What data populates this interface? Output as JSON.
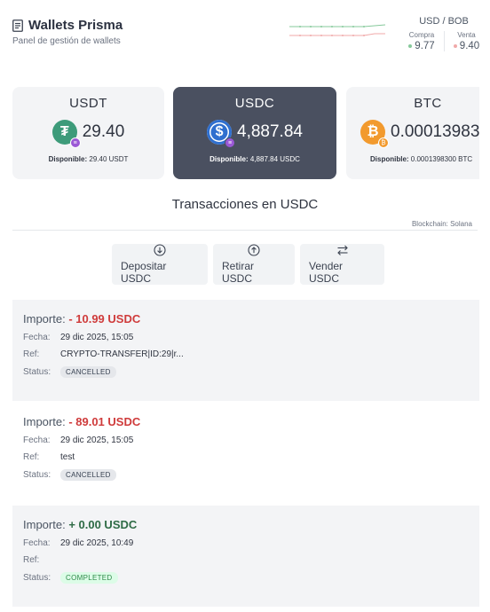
{
  "header": {
    "title": "Wallets Prisma",
    "subtitle": "Panel de gestión de wallets",
    "icon": "document-icon"
  },
  "rate": {
    "pair": "USD / BOB",
    "buy_label": "Compra",
    "sell_label": "Venta",
    "buy_value": "9.77",
    "sell_value": "9.40",
    "colors": {
      "buy": "#86c99b",
      "sell": "#f0a9a9"
    }
  },
  "cards": [
    {
      "name": "USDT",
      "balance": "29.40",
      "avail_label": "Disponible:",
      "avail_value": "29.40 USDT",
      "icon": "tether-icon",
      "color": "#3d9b7a",
      "badge_color": "#9b59d6",
      "active": false
    },
    {
      "name": "USDC",
      "balance": "4,887.84",
      "avail_label": "Disponible:",
      "avail_value": "4,887.84 USDC",
      "icon": "usdc-icon",
      "color": "#2f6fcf",
      "badge_color": "#9b59d6",
      "active": true
    },
    {
      "name": "BTC",
      "balance": "0.00013983",
      "avail_label": "Disponible:",
      "avail_value": "0.0001398300 BTC",
      "icon": "bitcoin-icon",
      "color": "#f29a2e",
      "badge_color": "#f29a2e",
      "active": false
    }
  ],
  "section": {
    "title": "Transacciones en USDC",
    "chain": "Blockchain: Solana"
  },
  "actions": [
    {
      "label": "Depositar USDC",
      "icon": "arrow-down-circle-icon"
    },
    {
      "label": "Retirar USDC",
      "icon": "arrow-up-circle-icon"
    },
    {
      "label": "Vender USDC",
      "icon": "swap-icon"
    }
  ],
  "tx_labels": {
    "amount": "Importe:",
    "date": "Fecha:",
    "ref": "Ref:",
    "status": "Status:"
  },
  "transactions": [
    {
      "amount": "- 10.99 USDC",
      "sign": "neg",
      "date": "29 dic 2025, 15:05",
      "ref": "CRYPTO-TRANSFER|ID:29|r...",
      "status": "CANCELLED"
    },
    {
      "amount": "- 89.01 USDC",
      "sign": "neg",
      "date": "29 dic 2025, 15:05",
      "ref": "test",
      "status": "CANCELLED"
    },
    {
      "amount": "+ 0.00 USDC",
      "sign": "pos",
      "date": "29 dic 2025, 10:49",
      "ref": "",
      "status": "COMPLETED"
    }
  ]
}
